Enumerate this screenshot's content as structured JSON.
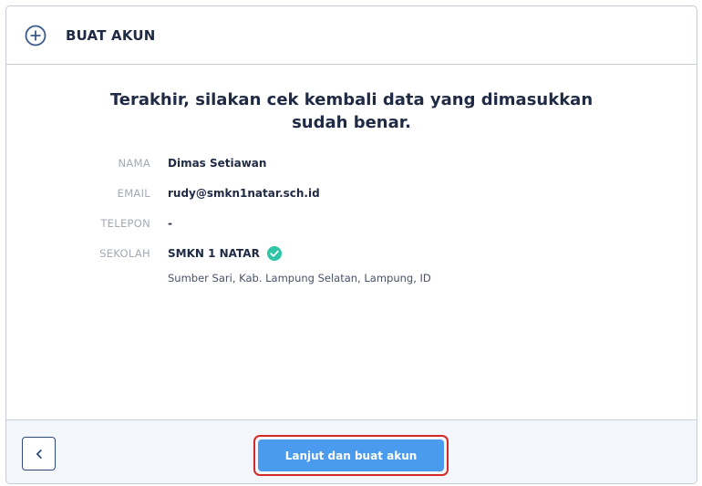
{
  "header": {
    "icon": "plus-circle-icon",
    "title": "BUAT AKUN"
  },
  "main": {
    "headline": "Terakhir, silakan cek kembali data yang dimasukkan sudah benar.",
    "fields": [
      {
        "label": "NAMA",
        "value": "Dimas Setiawan"
      },
      {
        "label": "EMAIL",
        "value": "rudy@smkn1natar.sch.id"
      },
      {
        "label": "TELEPON",
        "value": "-"
      },
      {
        "label": "SEKOLAH",
        "value": "SMKN 1 NATAR"
      }
    ],
    "school_verified_icon": "check-circle-icon",
    "school_address": "Sumber Sari, Kab. Lampung Selatan, Lampung, ID"
  },
  "footer": {
    "back_icon": "chevron-left-icon",
    "submit_label": "Lanjut dan buat akun"
  },
  "colors": {
    "primary": "#4a9bed",
    "verified": "#2ec4a6",
    "highlight": "#d62828",
    "text": "#1f2a44"
  }
}
